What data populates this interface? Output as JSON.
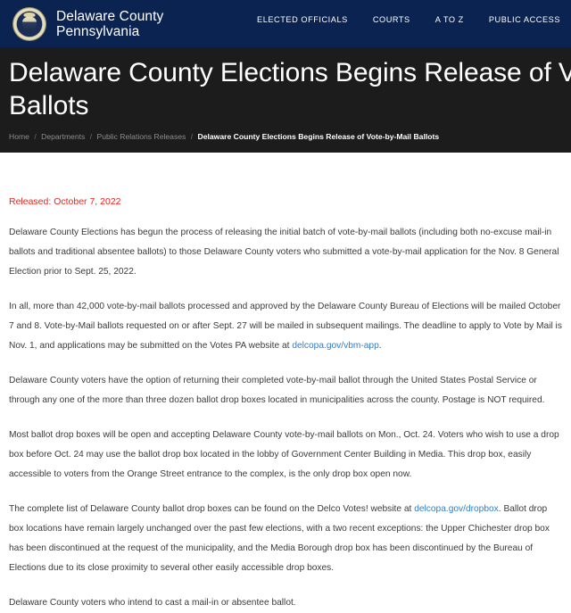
{
  "header": {
    "brand_line1": "Delaware County",
    "brand_line2": "Pennsylvania",
    "seal_icon": "county-seal-icon",
    "nav": [
      {
        "label": "ELECTED OFFICIALS"
      },
      {
        "label": "COURTS"
      },
      {
        "label": "A TO Z"
      },
      {
        "label": "PUBLIC ACCESS"
      }
    ]
  },
  "hero": {
    "title_line1": "Delaware County Elections Begins Release of Vote-by-Mail",
    "title_line2": "Ballots",
    "breadcrumb": {
      "home": "Home",
      "departments": "Departments",
      "releases": "Public Relations Releases",
      "current": "Delaware County Elections Begins Release of Vote-by-Mail Ballots",
      "separator": "/"
    }
  },
  "article": {
    "released": "Released: October 7, 2022",
    "p1": "Delaware County Elections has begun the process of releasing the initial batch of vote-by-mail ballots (including both no-excuse mail-in ballots and traditional absentee ballots) to those Delaware County voters who submitted a vote-by-mail application for the Nov. 8 General Election prior to Sept. 25, 2022.",
    "p2_before": "In all, more than 42,000 vote-by-mail ballots processed and approved by the Delaware County Bureau of Elections will be mailed October 7 and 8. Vote-by-Mail ballots requested on or after Sept. 27 will be mailed in subsequent mailings. The deadline to apply to Vote by Mail is Nov. 1, and applications may be submitted on the Votes PA website at ",
    "p2_link": "delcopa.gov/vbm-app",
    "p2_after": ".",
    "p3": "Delaware County voters have the option of returning their completed vote-by-mail ballot through the United States Postal Service or through any one of the more than three dozen ballot drop boxes located in municipalities across the county. Postage is NOT required.",
    "p4": "Most ballot drop boxes will be open and accepting Delaware County vote-by-mail ballots on Mon., Oct. 24. Voters who wish to use a drop box before Oct. 24 may use the ballot drop box located in the lobby of Government Center Building in Media. This drop box, easily accessible to voters from the Orange Street entrance to the complex, is the only drop box open now.",
    "p5_before": "The complete list of Delaware County ballot drop boxes can be found on the Delco Votes! website at ",
    "p5_link": "delcopa.gov/dropbox",
    "p5_after": ". Ballot drop box locations have remain largely unchanged over the past few elections, with a two recent exceptions: the Upper Chichester drop box has been discontinued at the request of the municipality, and the Media Borough drop box has been discontinued by the Bureau of Elections due to its close proximity to several other easily accessible drop boxes.",
    "p6": "Delaware County voters who intend to cast a mail-in or absentee ballot."
  },
  "colors": {
    "header_navy": "#0b2350",
    "hero_dark": "#1c1c1c",
    "released_red": "#e8241c",
    "link_blue": "#2f7fc7",
    "body_text": "#3a3a3a"
  }
}
